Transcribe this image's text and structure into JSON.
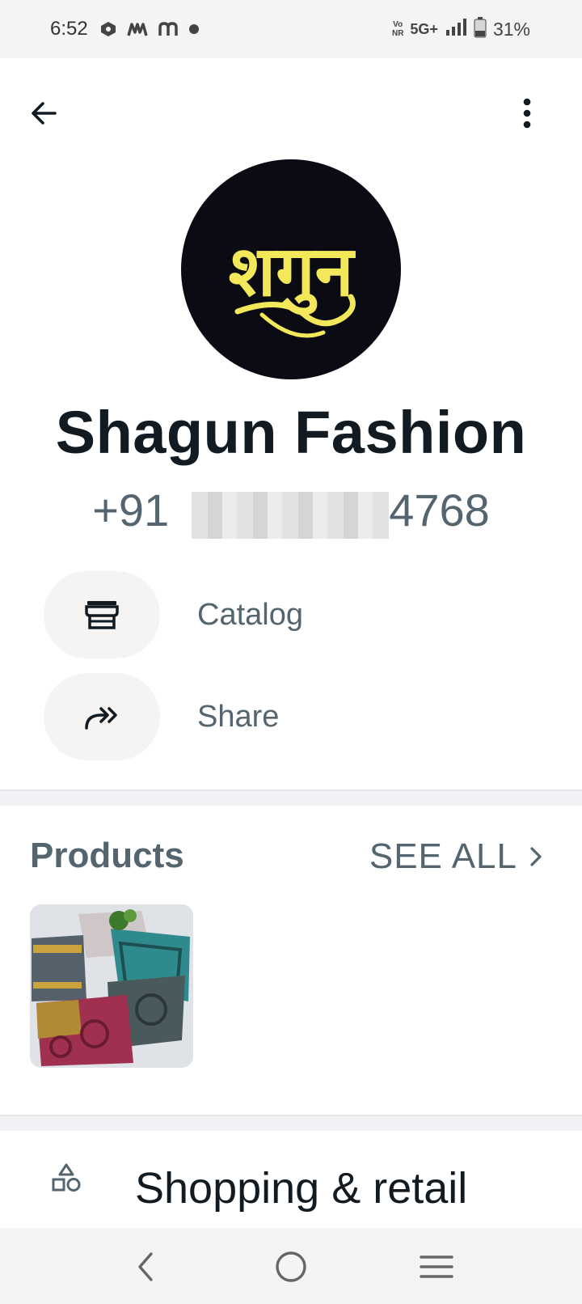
{
  "status_bar": {
    "time": "6:52",
    "volte_top": "Vo",
    "volte_bottom": "NR",
    "network": "5G+",
    "battery": "31%"
  },
  "toolbar": {
    "back_icon": "arrow-left-icon",
    "menu_icon": "more-vertical-icon"
  },
  "profile": {
    "name": "Shagun Fashion",
    "phone_prefix": "+91",
    "phone_suffix": "4768",
    "avatar_bg": "#0b0b14",
    "avatar_accent": "#f3e85a",
    "logo_text": "शगुन"
  },
  "actions": [
    {
      "label": "Catalog",
      "icon": "storefront-icon"
    },
    {
      "label": "Share",
      "icon": "forward-share-icon"
    }
  ],
  "products": {
    "title": "Products",
    "see_all": "SEE ALL"
  },
  "category": {
    "icon": "shapes-icon",
    "label": "Shopping & retail"
  },
  "nav_bar": {
    "back": "nav-back-icon",
    "home": "nav-home-icon",
    "recents": "nav-recents-icon"
  }
}
